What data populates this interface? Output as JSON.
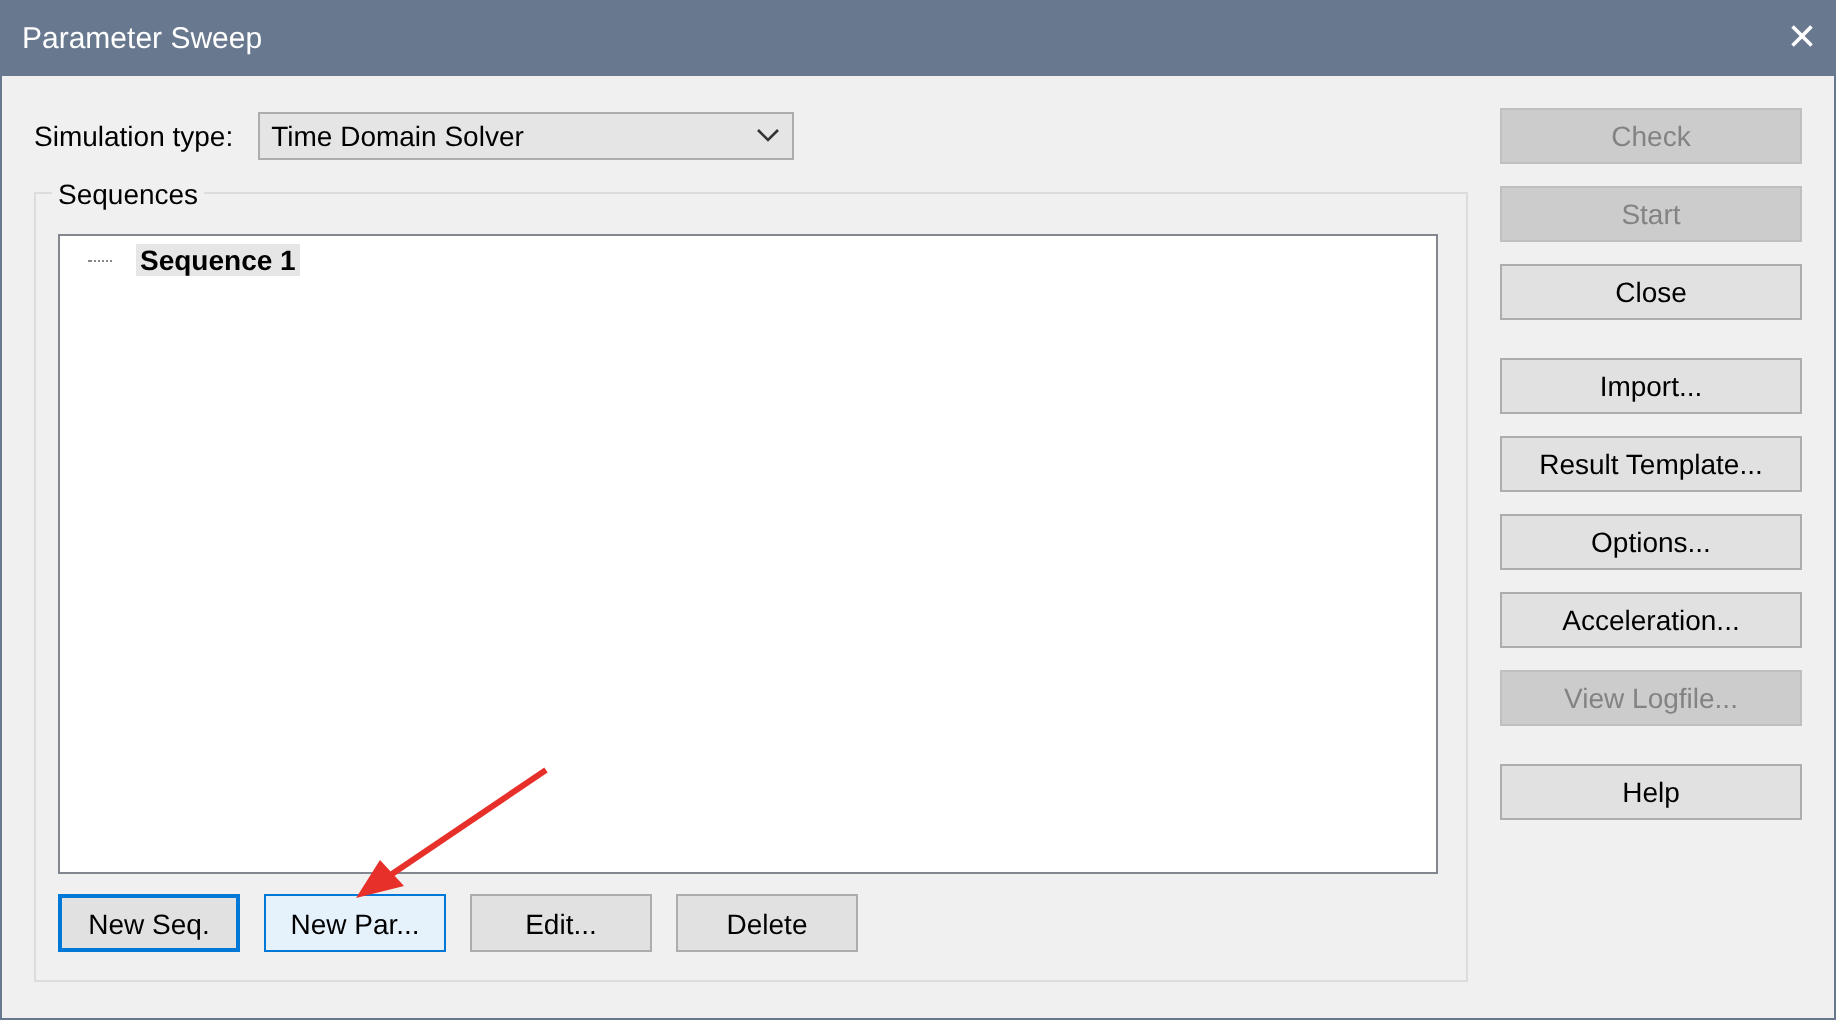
{
  "window": {
    "title": "Parameter Sweep",
    "close": "×"
  },
  "simulation_type": {
    "label": "Simulation type:",
    "value": "Time Domain Solver"
  },
  "sequences": {
    "label": "Sequences",
    "items": [
      {
        "label": "Sequence 1",
        "selected": true
      }
    ]
  },
  "bottom_buttons": [
    {
      "label": "New Seq.",
      "focused": true,
      "hovered": false
    },
    {
      "label": "New Par...",
      "focused": false,
      "hovered": true
    },
    {
      "label": "Edit...",
      "focused": false,
      "hovered": false
    },
    {
      "label": "Delete",
      "focused": false,
      "hovered": false
    }
  ],
  "side_groups": [
    [
      {
        "label": "Check",
        "disabled": true
      },
      {
        "label": "Start",
        "disabled": true
      },
      {
        "label": "Close",
        "disabled": false
      }
    ],
    [
      {
        "label": "Import...",
        "disabled": false
      },
      {
        "label": "Result Template...",
        "disabled": false
      },
      {
        "label": "Options...",
        "disabled": false
      },
      {
        "label": "Acceleration...",
        "disabled": false
      },
      {
        "label": "View Logfile...",
        "disabled": true
      }
    ],
    [
      {
        "label": "Help",
        "disabled": false
      }
    ]
  ]
}
